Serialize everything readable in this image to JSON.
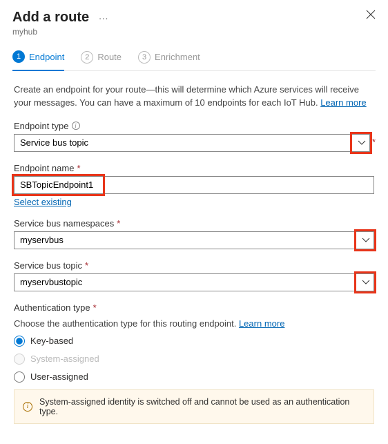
{
  "header": {
    "title": "Add a route",
    "subtitle": "myhub"
  },
  "steps": [
    {
      "num": "1",
      "label": "Endpoint"
    },
    {
      "num": "2",
      "label": "Route"
    },
    {
      "num": "3",
      "label": "Enrichment"
    }
  ],
  "intro": {
    "text": "Create an endpoint for your route—this will determine which Azure services will receive your messages. You can have a maximum of 10 endpoints for each IoT Hub. ",
    "link": "Learn more"
  },
  "fields": {
    "endpointType": {
      "label": "Endpoint type",
      "value": "Service bus topic"
    },
    "endpointName": {
      "label": "Endpoint name",
      "value": "SBTopicEndpoint1",
      "selectExisting": "Select existing"
    },
    "namespace": {
      "label": "Service bus namespaces",
      "value": "myservbus"
    },
    "topic": {
      "label": "Service bus topic",
      "value": "myservbustopic"
    },
    "authType": {
      "label": "Authentication type",
      "desc": "Choose the authentication type for this routing endpoint. ",
      "link": "Learn more",
      "options": {
        "key": "Key-based",
        "system": "System-assigned",
        "user": "User-assigned"
      }
    }
  },
  "warning": "System-assigned identity is switched off and cannot be used as an authentication type."
}
